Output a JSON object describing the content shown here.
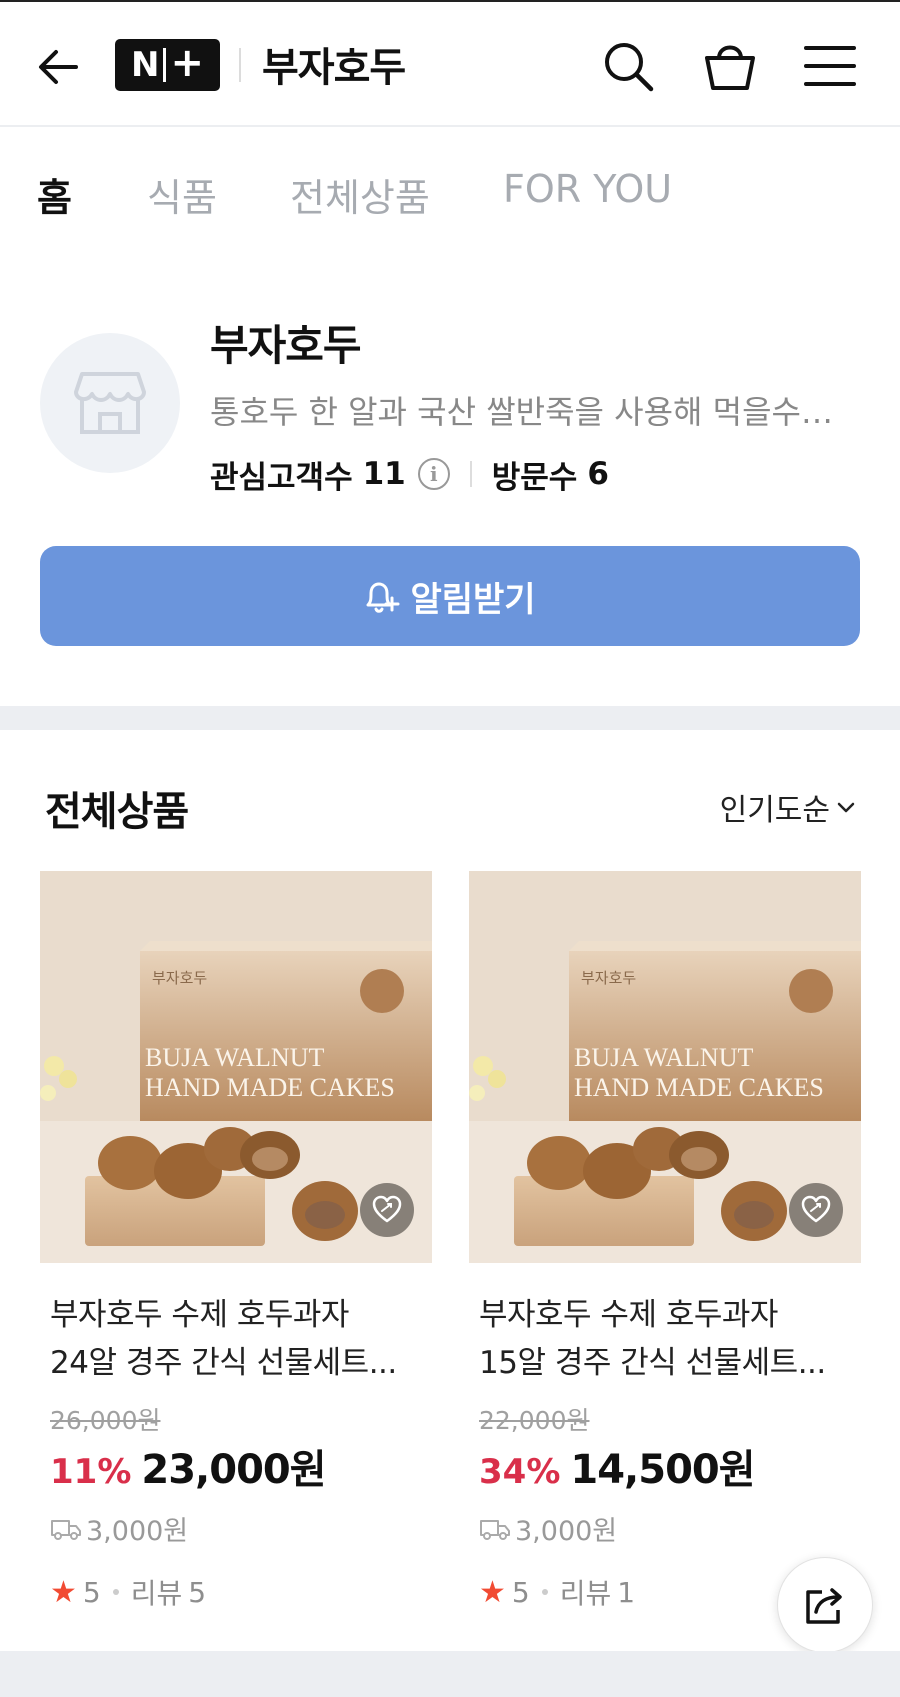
{
  "header": {
    "back_icon": "arrow-left-icon",
    "logo_text": "N+",
    "title": "부자호두",
    "icons": [
      "search-icon",
      "shopping-bag-icon",
      "menu-icon"
    ]
  },
  "tabs": [
    {
      "label": "홈",
      "active": true
    },
    {
      "label": "식품",
      "active": false
    },
    {
      "label": "전체상품",
      "active": false
    },
    {
      "label": "FOR YOU",
      "active": false
    }
  ],
  "profile": {
    "name": "부자호두",
    "description": "통호두 한 알과 국산 쌀반죽을 사용해 먹을수록...",
    "followers_label": "관심고객수",
    "followers_count": "11",
    "info_icon": "info-icon",
    "visits_label": "방문수",
    "visits_count": "6",
    "avatar_icon": "store-icon"
  },
  "notify_button": {
    "label": "알림받기",
    "icon": "bell-plus-icon",
    "color": "#6b95dc"
  },
  "products_section": {
    "title": "전체상품",
    "sort_label": "인기도순",
    "products": [
      {
        "name_line1": "부자호두 수제 호두과자",
        "name_line2": "24알 경주 간식 선물세트...",
        "original_price": "26,000원",
        "discount": "11%",
        "price": "23,000원",
        "shipping": "3,000원",
        "rating": "5",
        "review_label": "리뷰",
        "review_count": "5",
        "image_text_brand": "부자호두",
        "image_text_line1": "BUJA WALNUT",
        "image_text_line2": "HAND MADE CAKES"
      },
      {
        "name_line1": "부자호두 수제 호두과자",
        "name_line2": "15알 경주 간식 선물세트...",
        "original_price": "22,000원",
        "discount": "34%",
        "price": "14,500원",
        "shipping": "3,000원",
        "rating": "5",
        "review_label": "리뷰",
        "review_count": "1",
        "image_text_brand": "부자호두",
        "image_text_line1": "BUJA WALNUT",
        "image_text_line2": "HAND MADE CAKES"
      }
    ]
  },
  "share_icon": "share-icon",
  "colors": {
    "discount": "#d92f4a",
    "star": "#f14b33",
    "accent_button": "#6b95dc"
  }
}
